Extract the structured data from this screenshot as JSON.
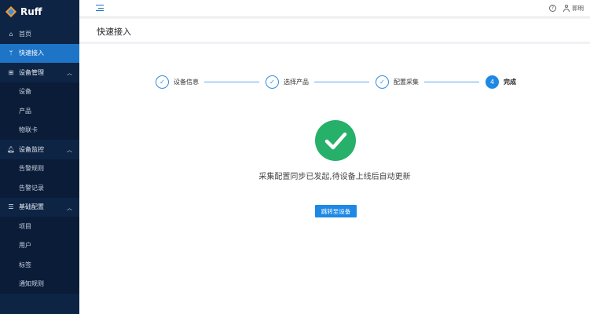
{
  "app": {
    "logo_text": "Ruff"
  },
  "sidebar": {
    "items": [
      {
        "label": "首页",
        "icon": "home-icon"
      },
      {
        "label": "快速接入",
        "icon": "branch-icon",
        "active": true
      },
      {
        "label": "设备管理",
        "icon": "grid-icon",
        "group": true
      },
      {
        "label": "设备"
      },
      {
        "label": "产品"
      },
      {
        "label": "物联卡"
      },
      {
        "label": "设备监控",
        "icon": "bell-icon",
        "group": true
      },
      {
        "label": "告警规则"
      },
      {
        "label": "告警记录"
      },
      {
        "label": "基础配置",
        "icon": "list-icon",
        "group": true
      },
      {
        "label": "项目"
      },
      {
        "label": "用户"
      },
      {
        "label": "标签"
      },
      {
        "label": "通知规则"
      }
    ]
  },
  "topbar": {
    "user_name": "郭明"
  },
  "page": {
    "title": "快速接入"
  },
  "steps": [
    {
      "label": "设备信息",
      "status": "done"
    },
    {
      "label": "选择产品",
      "status": "done"
    },
    {
      "label": "配置采集",
      "status": "done"
    },
    {
      "label": "完成",
      "status": "current",
      "number": "4"
    }
  ],
  "result": {
    "message": "采集配置同步已发起,待设备上线后自动更新",
    "button_label": "跳转至设备"
  },
  "colors": {
    "sidebar_bg": "#0e2444",
    "accent": "#1e88e5",
    "success": "#27b06a"
  }
}
